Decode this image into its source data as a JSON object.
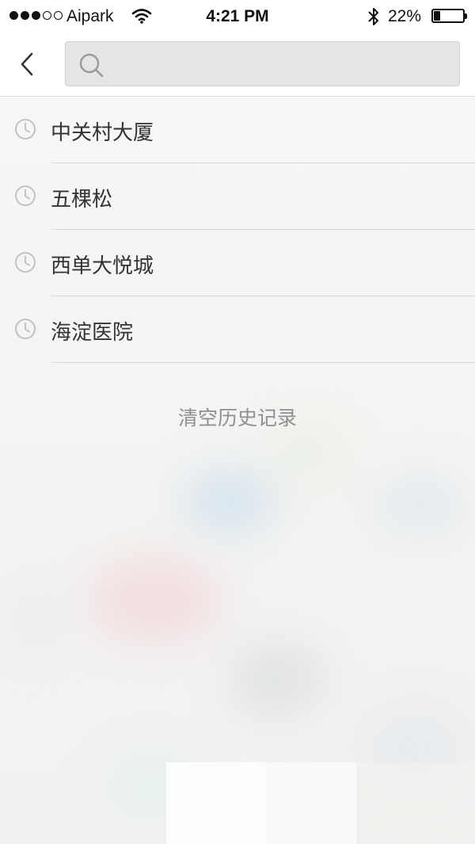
{
  "status_bar": {
    "carrier": "Aipark",
    "time": "4:21 PM",
    "battery_percent": "22%",
    "battery_level": 0.22,
    "signal_bars_filled": 3,
    "signal_bars_total": 5,
    "icons": [
      "wifi-icon",
      "bluetooth-icon",
      "battery-icon"
    ]
  },
  "nav": {
    "back_icon": "chevron-left-icon",
    "search": {
      "value": "",
      "placeholder": "",
      "icon": "search-icon"
    }
  },
  "history": {
    "item_icon": "clock-icon",
    "items": [
      {
        "label": "中关村大厦"
      },
      {
        "label": "五棵松"
      },
      {
        "label": "西单大悦城"
      },
      {
        "label": "海淀医院"
      }
    ],
    "clear_label": "清空历史记录"
  },
  "colors": {
    "text_primary": "#333333",
    "text_secondary": "#8f8f8f",
    "icon_gray": "#bdbdbd",
    "search_bg": "#e5e5e5"
  }
}
